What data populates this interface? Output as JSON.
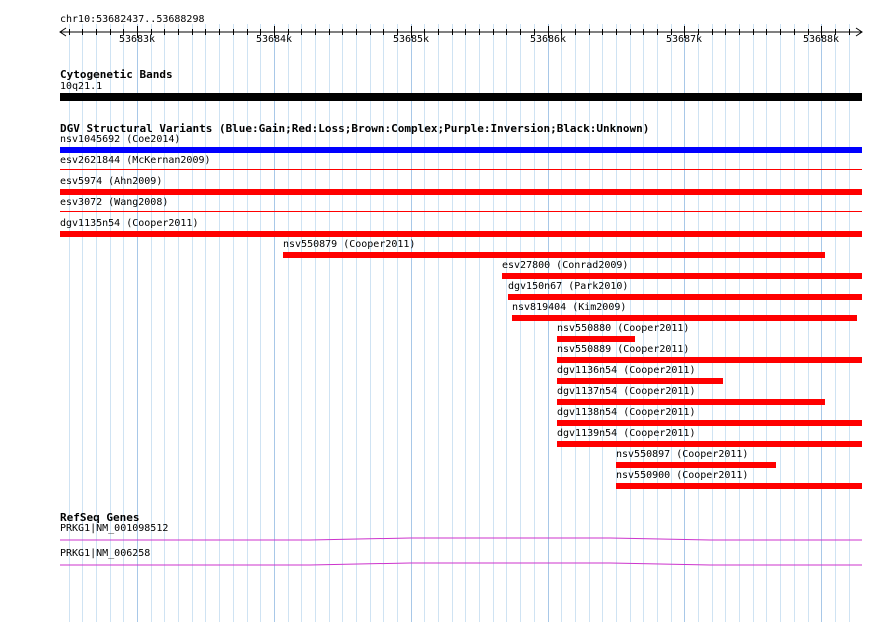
{
  "ruler": {
    "position_label": "chr10:53682437..53688298",
    "start": 53682437,
    "end": 53688298,
    "ticks": [
      "53683k",
      "53684k",
      "53685k",
      "53686k",
      "53687k",
      "53688k"
    ]
  },
  "tracks": {
    "cytoband": {
      "title": "Cytogenetic Bands",
      "label": "10q21.1",
      "color": "#000000"
    },
    "dgv": {
      "title": "DGV Structural Variants (Blue:Gain;Red:Loss;Brown:Complex;Purple:Inversion;Black:Unknown)",
      "features": [
        {
          "label": "nsv1045692 (Coe2014)",
          "start": 53682437,
          "end": 53688298,
          "color": "#0000ff",
          "style": "thick"
        },
        {
          "label": "esv2621844 (McKernan2009)",
          "start": 53682437,
          "end": 53688298,
          "color": "#ff0000",
          "style": "thin"
        },
        {
          "label": "esv5974 (Ahn2009)",
          "start": 53682437,
          "end": 53688298,
          "color": "#ff0000",
          "style": "thick"
        },
        {
          "label": "esv3072 (Wang2008)",
          "start": 53682437,
          "end": 53688298,
          "color": "#ff0000",
          "style": "thin"
        },
        {
          "label": "dgv1135n54 (Cooper2011)",
          "start": 53682437,
          "end": 53688298,
          "color": "#ff0000",
          "style": "thick"
        },
        {
          "label": "nsv550879 (Cooper2011)",
          "start": 53684070,
          "end": 53688030,
          "color": "#ff0000",
          "style": "thick"
        },
        {
          "label": "esv27800 (Conrad2009)",
          "start": 53685670,
          "end": 53688298,
          "color": "#ff0000",
          "style": "thick"
        },
        {
          "label": "dgv150n67 (Park2010)",
          "start": 53685710,
          "end": 53688298,
          "color": "#ff0000",
          "style": "thick"
        },
        {
          "label": "nsv819404 (Kim2009)",
          "start": 53685740,
          "end": 53688260,
          "color": "#ff0000",
          "style": "thick"
        },
        {
          "label": "nsv550880 (Cooper2011)",
          "start": 53686070,
          "end": 53686640,
          "color": "#ff0000",
          "style": "thick"
        },
        {
          "label": "nsv550889 (Cooper2011)",
          "start": 53686070,
          "end": 53688298,
          "color": "#ff0000",
          "style": "thick"
        },
        {
          "label": "dgv1136n54 (Cooper2011)",
          "start": 53686070,
          "end": 53687280,
          "color": "#ff0000",
          "style": "thick"
        },
        {
          "label": "dgv1137n54 (Cooper2011)",
          "start": 53686070,
          "end": 53688030,
          "color": "#ff0000",
          "style": "thick"
        },
        {
          "label": "dgv1138n54 (Cooper2011)",
          "start": 53686070,
          "end": 53688298,
          "color": "#ff0000",
          "style": "thick"
        },
        {
          "label": "dgv1139n54 (Cooper2011)",
          "start": 53686070,
          "end": 53688298,
          "color": "#ff0000",
          "style": "thick"
        },
        {
          "label": "nsv550897 (Cooper2011)",
          "start": 53686500,
          "end": 53687670,
          "color": "#ff0000",
          "style": "thick"
        },
        {
          "label": "nsv550900 (Cooper2011)",
          "start": 53686500,
          "end": 53688298,
          "color": "#ff0000",
          "style": "thick"
        }
      ]
    },
    "refseq": {
      "title": "RefSeq Genes",
      "color": "#cc33cc",
      "features": [
        {
          "label": "PRKG1|NM_001098512"
        },
        {
          "label": "PRKG1|NM_006258"
        }
      ]
    }
  }
}
